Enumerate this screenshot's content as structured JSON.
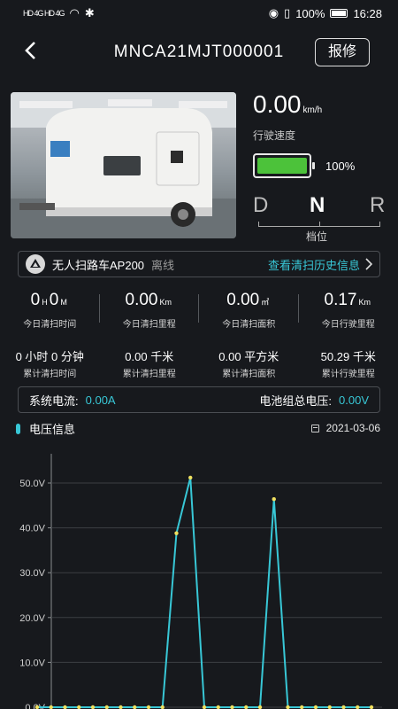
{
  "status_bar": {
    "left": "HD 4G HD 4G",
    "battery": "100%",
    "time": "16:28"
  },
  "header": {
    "title": "MNCA21MJT000001",
    "repair_label": "报修"
  },
  "speed": {
    "value": "0.00",
    "unit": "km/h",
    "label": "行驶速度"
  },
  "battery": {
    "percent": "100%",
    "level": 1.0,
    "color": "#4cc23a"
  },
  "gear": {
    "options": [
      "D",
      "N",
      "R"
    ],
    "selected": "N",
    "label": "档位"
  },
  "vehicle": {
    "name": "无人扫路车AP200",
    "status": "离线",
    "history_link": "查看清扫历史信息"
  },
  "today_stats": [
    {
      "value": "0",
      "unit1": "H",
      "value2": "0",
      "unit2": "M",
      "label": "今日清扫时间"
    },
    {
      "value": "0.00",
      "unit": "Km",
      "label": "今日清扫里程"
    },
    {
      "value": "0.00",
      "unit": "㎡",
      "label": "今日清扫面积"
    },
    {
      "value": "0.17",
      "unit": "Km",
      "label": "今日行驶里程"
    }
  ],
  "total_stats": [
    {
      "value": "0 小时 0 分钟",
      "label": "累计清扫时间"
    },
    {
      "value": "0.00 千米",
      "label": "累计清扫里程"
    },
    {
      "value": "0.00 平方米",
      "label": "累计清扫面积"
    },
    {
      "value": "50.29 千米",
      "label": "累计行驶里程"
    }
  ],
  "electric": {
    "current_label": "系统电流:",
    "current_value": "0.00A",
    "voltage_label": "电池组总电压:",
    "voltage_value": "0.00V"
  },
  "voltage_section": {
    "title": "电压信息",
    "date": "2021-03-06"
  },
  "colors": {
    "accent": "#38c7d6",
    "point": "#f0e060"
  },
  "chart_data": {
    "type": "line",
    "title": "",
    "xlabel": "",
    "ylabel": "",
    "ylim": [
      0,
      50
    ],
    "ytick_labels": [
      "50.0V",
      "40.0V",
      "30.0V",
      "20.0V",
      "10.0V",
      "0.0V"
    ],
    "ytick_values": [
      50,
      40,
      30,
      20,
      10,
      0
    ],
    "grid": true,
    "series": [
      {
        "values": [
          0,
          0,
          0,
          0,
          0,
          0,
          0,
          0,
          0,
          0,
          38.8,
          51.2,
          0,
          0,
          0,
          0,
          0,
          46.4,
          0,
          0,
          0,
          0,
          0,
          0,
          0
        ]
      }
    ]
  }
}
